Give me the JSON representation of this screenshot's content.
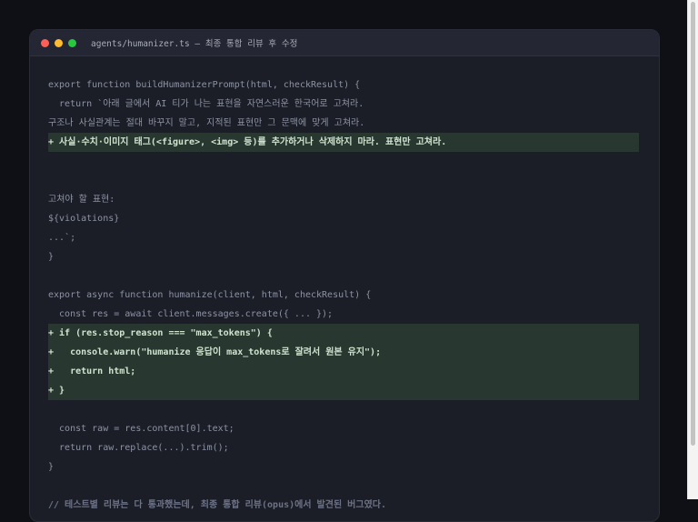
{
  "window": {
    "title": "agents/humanizer.ts — 최종 통합 리뷰 후 수정",
    "traffic_lights": {
      "close": "#ff5f57",
      "minimize": "#febc2e",
      "zoom": "#28c840"
    }
  },
  "code_lines": [
    {
      "text": "export function buildHumanizerPrompt(html, checkResult) {",
      "kind": "normal"
    },
    {
      "text": "  return `아래 글에서 AI 티가 나는 표현을 자연스러운 한국어로 고쳐라.",
      "kind": "normal"
    },
    {
      "text": "구조나 사실관계는 절대 바꾸지 말고, 지적된 표현만 그 문맥에 맞게 고쳐라.",
      "kind": "normal"
    },
    {
      "text": "+ 사실·수치·이미지 태그(<figure>, <img> 등)를 추가하거나 삭제하지 마라. 표현만 고쳐라.",
      "kind": "add"
    },
    {
      "text": "",
      "kind": "normal"
    },
    {
      "text": "",
      "kind": "normal"
    },
    {
      "text": "고쳐야 할 표현:",
      "kind": "normal"
    },
    {
      "text": "${violations}",
      "kind": "normal"
    },
    {
      "text": "...`;",
      "kind": "normal"
    },
    {
      "text": "}",
      "kind": "normal"
    },
    {
      "text": "",
      "kind": "normal"
    },
    {
      "text": "export async function humanize(client, html, checkResult) {",
      "kind": "normal"
    },
    {
      "text": "  const res = await client.messages.create({ ... });",
      "kind": "normal"
    },
    {
      "text": "+ if (res.stop_reason === \"max_tokens\") {",
      "kind": "add"
    },
    {
      "text": "+   console.warn(\"humanize 응답이 max_tokens로 잘려서 원본 유지\");",
      "kind": "add"
    },
    {
      "text": "+   return html;",
      "kind": "add"
    },
    {
      "text": "+ }",
      "kind": "add"
    },
    {
      "text": "",
      "kind": "normal"
    },
    {
      "text": "  const raw = res.content[0].text;",
      "kind": "normal"
    },
    {
      "text": "  return raw.replace(...).trim();",
      "kind": "normal"
    },
    {
      "text": "}",
      "kind": "normal"
    },
    {
      "text": "",
      "kind": "normal"
    },
    {
      "text": "// 테스트별 리뷰는 다 통과했는데, 최종 통합 리뷰(opus)에서 발견된 버그였다.",
      "kind": "comment"
    }
  ]
}
